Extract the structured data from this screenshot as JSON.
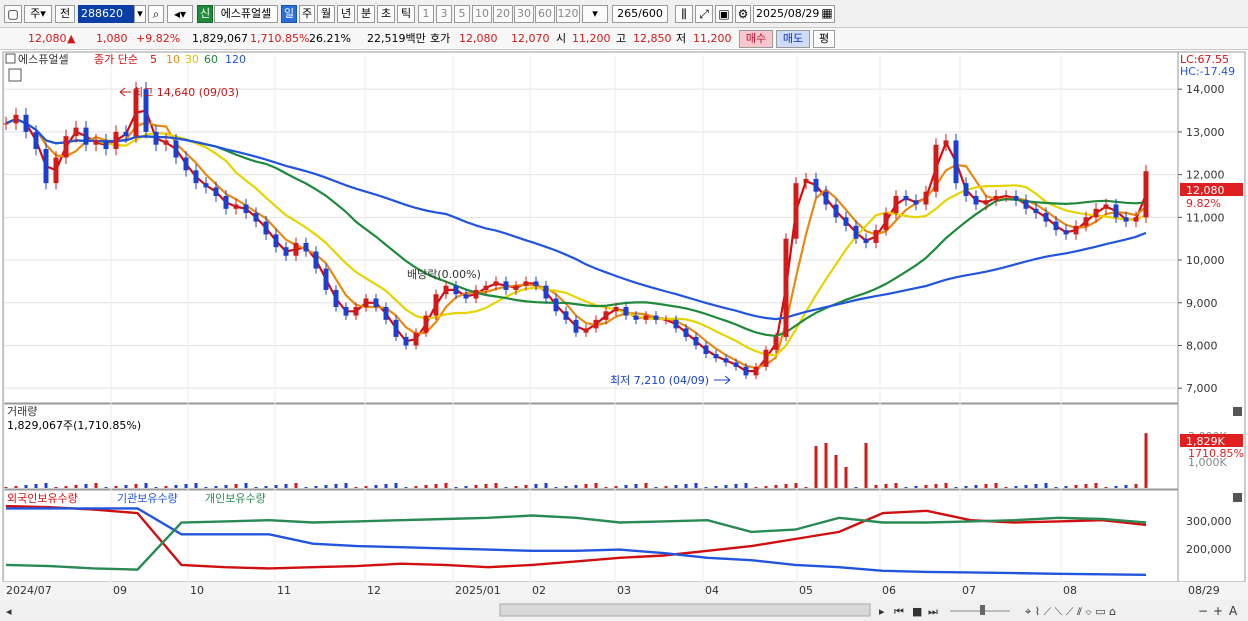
{
  "toolbar": {
    "period_label": "주",
    "prev_label": "전",
    "code": "288620",
    "badge": "신",
    "stock_name": "에스퓨얼셀",
    "tf_day": "일",
    "tf_week": "주",
    "tf_month": "월",
    "tf_year": "년",
    "tf_min": "분",
    "tf_sec": "초",
    "tf_tick": "틱",
    "n1": "1",
    "n3": "3",
    "n5": "5",
    "n10": "10",
    "n20": "20",
    "n30": "30",
    "n60": "60",
    "n120": "120",
    "count": "265",
    "count_total": "/600",
    "date": "2025/08/29"
  },
  "quote": {
    "price": "12,080",
    "price_arrow": "▲",
    "change": "1,080",
    "change_pct": "+9.82%",
    "volume": "1,829,067",
    "volume_pct": "1,710.85%",
    "turnover": "26.21%",
    "amount": "22,519백만",
    "hoga_label": "호가",
    "ask": "12,080",
    "bid": "12,070",
    "open_label": "시",
    "open": "11,200",
    "high_label": "고",
    "high": "12,850",
    "low_label": "저",
    "low": "11,200",
    "buy_label": "매수",
    "sell_label": "매도",
    "eval_label": "평"
  },
  "main": {
    "legend_name": "에스퓨얼셀",
    "legend_ma_label": "종가 단순",
    "ma_periods": [
      "5",
      "10",
      "30",
      "60",
      "120"
    ],
    "ma_colors": [
      "#d01010",
      "#e88a10",
      "#e6d400",
      "#1e8a3a",
      "#2255dd"
    ],
    "lc_label": "LC:67.55",
    "hc_label": "HC:-17.49",
    "high_annotation": "최고 14,640 (09/03)",
    "low_annotation": "최저 7,210 (04/09)",
    "dividend_annotation": "배당락(0.00%)",
    "current_price": "12,080",
    "current_pct": "9.82%",
    "up_color": "#d21a1a",
    "down_color": "#1a3fd2"
  },
  "volume_panel": {
    "title": "거래량",
    "summary": "1,829,067주(1,710.85%)",
    "tick_label": "2,000K",
    "tick_label_low": "1,000K",
    "current": "1,829K",
    "current_pct": "1710.85%"
  },
  "holdings_panel": {
    "foreign_label": "외국인보유수량",
    "inst_label": "기관보유수량",
    "indiv_label": "개인보유수량",
    "foreign_color": "#d01010",
    "inst_color": "#2255dd",
    "indiv_color": "#2a8a55",
    "tick_labels": [
      "300,000",
      "200,000"
    ]
  },
  "x_axis": {
    "labels": [
      "2024/07",
      "09",
      "10",
      "11",
      "12",
      "2025/01",
      "02",
      "03",
      "04",
      "05",
      "06",
      "07",
      "08"
    ],
    "end_label": "08/29"
  },
  "chart_data": {
    "type": "candlestick",
    "x_axis_labels": [
      "2024/07",
      "09",
      "10",
      "11",
      "12",
      "2025/01",
      "02",
      "03",
      "04",
      "05",
      "06",
      "07",
      "08",
      "08/29"
    ],
    "y_ticks": [
      7000,
      8000,
      9000,
      10000,
      11000,
      12000,
      13000,
      14000
    ],
    "ylim": [
      6700,
      14800
    ],
    "moving_averages": [
      5,
      10,
      30,
      60,
      120
    ],
    "close_series": [
      13200,
      13400,
      13000,
      12600,
      11800,
      12400,
      12900,
      13100,
      12700,
      12800,
      12600,
      13000,
      12900,
      14000,
      13000,
      12700,
      12800,
      12400,
      12100,
      11800,
      11700,
      11500,
      11200,
      11300,
      11100,
      10900,
      10600,
      10300,
      10100,
      10400,
      10200,
      9800,
      9300,
      8900,
      8700,
      8900,
      9100,
      8900,
      8600,
      8200,
      8000,
      8300,
      8700,
      9200,
      9400,
      9200,
      9100,
      9300,
      9400,
      9500,
      9300,
      9400,
      9500,
      9400,
      9100,
      8800,
      8600,
      8300,
      8400,
      8600,
      8800,
      8900,
      8700,
      8600,
      8700,
      8600,
      8600,
      8400,
      8200,
      8000,
      7800,
      7700,
      7600,
      7500,
      7300,
      7500,
      7900,
      8200,
      10500,
      11800,
      11900,
      11600,
      11300,
      11000,
      10800,
      10500,
      10400,
      10700,
      11100,
      11500,
      11400,
      11300,
      11600,
      12700,
      12800,
      11800,
      11500,
      11300,
      11400,
      11500,
      11500,
      11400,
      11200,
      11100,
      10900,
      10700,
      10600,
      10800,
      11000,
      11200,
      11300,
      11000,
      10900,
      11000,
      12080
    ],
    "volume_max_k": 2000,
    "volume_last_k": 1829,
    "volume_spikes_k": [
      0,
      0,
      1400,
      1500,
      1100,
      700,
      0,
      1500,
      0,
      0,
      0,
      1829
    ],
    "holdings": {
      "foreign": [
        370000,
        365000,
        355000,
        340000,
        120000,
        110000,
        105000,
        110000,
        115000,
        125000,
        120000,
        110000,
        120000,
        135000,
        150000,
        160000,
        180000,
        200000,
        230000,
        260000,
        340000,
        350000,
        310000,
        300000,
        305000,
        310000,
        290000
      ],
      "institution": [
        360000,
        360000,
        360000,
        360000,
        250000,
        250000,
        250000,
        210000,
        200000,
        195000,
        190000,
        185000,
        180000,
        180000,
        185000,
        170000,
        150000,
        140000,
        120000,
        110000,
        95000,
        90000,
        88000,
        85000,
        82000,
        80000,
        78000
      ],
      "individual": [
        120000,
        115000,
        105000,
        100000,
        300000,
        305000,
        310000,
        300000,
        305000,
        310000,
        315000,
        320000,
        330000,
        320000,
        300000,
        305000,
        310000,
        260000,
        270000,
        320000,
        300000,
        300000,
        305000,
        310000,
        320000,
        315000,
        300000
      ],
      "ylim": [
        60000,
        400000
      ]
    }
  }
}
